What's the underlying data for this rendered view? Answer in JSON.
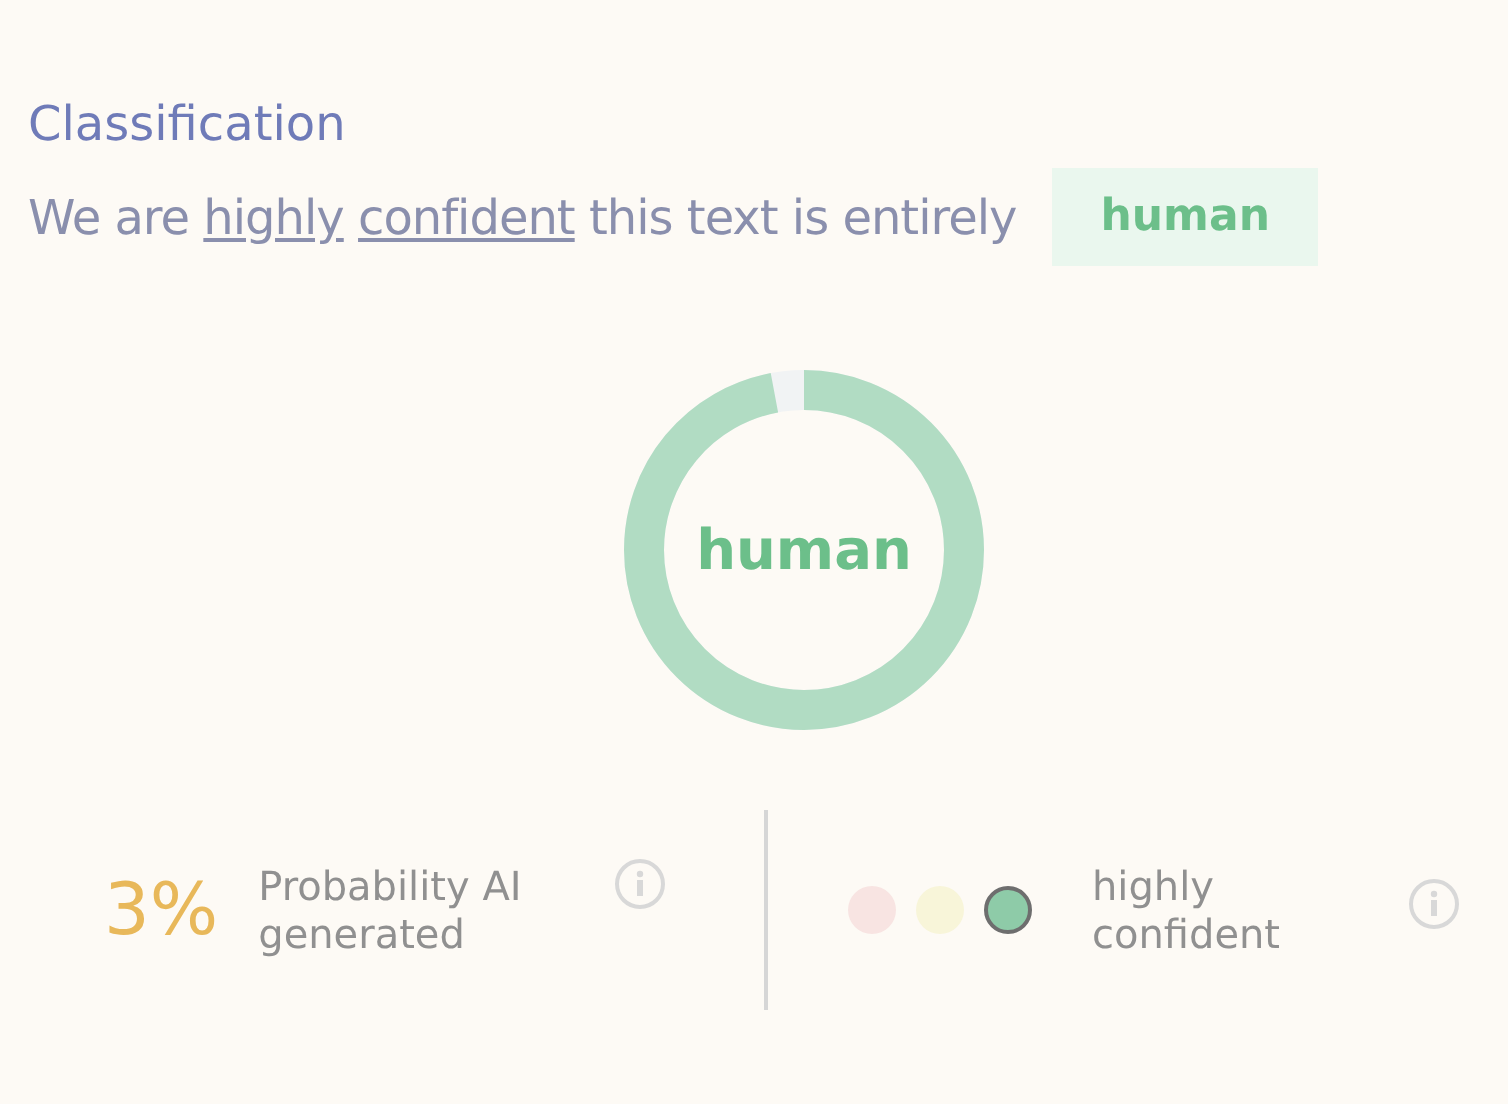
{
  "heading": "Classification",
  "summary": {
    "parts": [
      {
        "kind": "text",
        "text": "We are"
      },
      {
        "kind": "link",
        "text": "highly"
      },
      {
        "kind": "link",
        "text": "confident"
      },
      {
        "kind": "text",
        "text": "this text is entirely"
      }
    ],
    "verdict": "human"
  },
  "gauge": {
    "label": "human",
    "level": 0.97
  },
  "probability": {
    "value": "3%",
    "label": "Probability AI generated"
  },
  "confidence": {
    "dots": [
      {
        "color": "#f8e4e2",
        "selected": false
      },
      {
        "color": "#f8f5d9",
        "selected": false
      },
      {
        "color": "#8ecba8",
        "selected": true
      }
    ],
    "label": "highly confident"
  }
}
